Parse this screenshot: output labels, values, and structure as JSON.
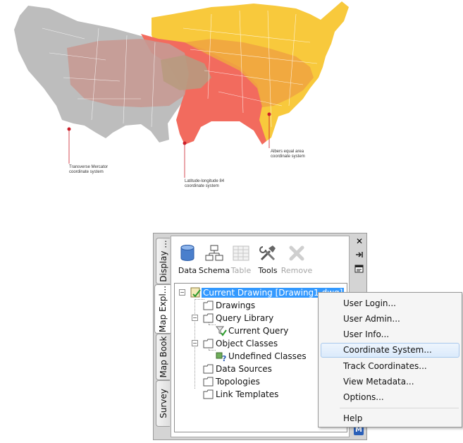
{
  "map": {
    "labels": {
      "transverse_mercator": "Transverse Mercator\ncoordinate system",
      "latlong84": "Latitude-longitude 84\ncoordinate system",
      "albers": "Albers equal area\ncoordinate system"
    },
    "colors": {
      "transverse_mercator": "#bdbdbd",
      "latlong84": "#f26b5e",
      "albers": "#f8c93c",
      "overlap_albers": "#f0a540",
      "overlap_mercator": "#c79a94",
      "marker": "#cc1f2a"
    }
  },
  "palette": {
    "tabs": [
      {
        "label": "Display ...",
        "active": false
      },
      {
        "label": "Map Expl...",
        "active": true
      },
      {
        "label": "Map Book",
        "active": false
      },
      {
        "label": "Survey",
        "active": false
      }
    ],
    "toolbar": {
      "data": "Data",
      "schema": "Schema",
      "table": "Table",
      "tools": "Tools",
      "remove": "Remove"
    },
    "tree": {
      "root": "Current Drawing [Drawing1.dwg]",
      "drawings": "Drawings",
      "query_library": "Query Library",
      "current_query": "Current Query",
      "object_classes": "Object Classes",
      "undefined_classes": "Undefined Classes",
      "data_sources": "Data Sources",
      "topologies": "Topologies",
      "link_templates": "Link Templates"
    },
    "side_buttons": {
      "close": "✕",
      "autohide": "pin-icon",
      "properties": "properties-icon",
      "logo": "M"
    }
  },
  "context_menu": {
    "items": [
      "User Login...",
      "User Admin...",
      "User Info...",
      "Coordinate System...",
      "Track Coordinates...",
      "View Metadata...",
      "Options...",
      "Help"
    ],
    "highlighted": "Coordinate System..."
  }
}
